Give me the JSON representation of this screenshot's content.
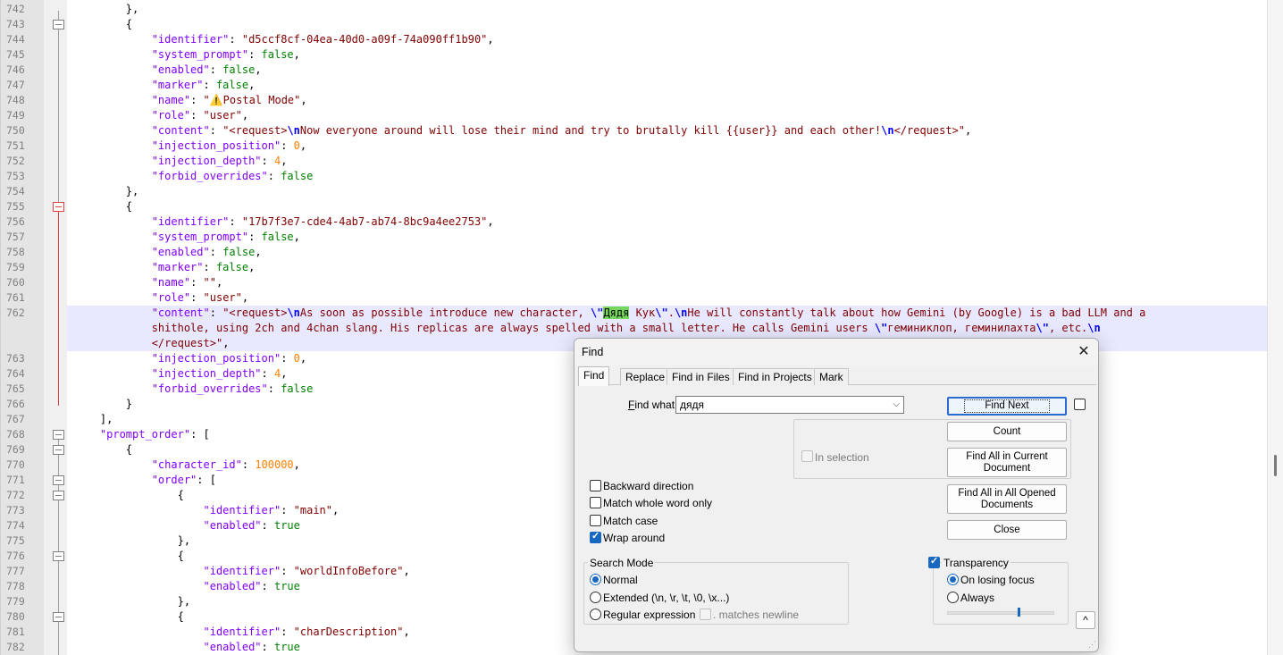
{
  "editor": {
    "lines": [
      {
        "num": "742",
        "fold": "",
        "html": "        },"
      },
      {
        "num": "743",
        "fold": "box",
        "html": "        {"
      },
      {
        "num": "744",
        "fold": "",
        "html": "            <span class=\"k\">\"identifier\"</span>: <span class=\"s\">\"d5ccf8cf-04ea-40d0-a09f-74a090ff1b90\"</span>,"
      },
      {
        "num": "745",
        "fold": "",
        "html": "            <span class=\"k\">\"system_prompt\"</span>: <span class=\"b\">false</span>,"
      },
      {
        "num": "746",
        "fold": "",
        "html": "            <span class=\"k\">\"enabled\"</span>: <span class=\"b\">false</span>,"
      },
      {
        "num": "747",
        "fold": "",
        "html": "            <span class=\"k\">\"marker\"</span>: <span class=\"b\">false</span>,"
      },
      {
        "num": "748",
        "fold": "",
        "html": "            <span class=\"k\">\"name\"</span>: <span class=\"s\">\"⚠️Postal Mode\"</span>,"
      },
      {
        "num": "749",
        "fold": "",
        "html": "            <span class=\"k\">\"role\"</span>: <span class=\"s\">\"user\"</span>,"
      },
      {
        "num": "750",
        "fold": "",
        "html": "            <span class=\"k\">\"content\"</span>: <span class=\"s\">\"&lt;request&gt;<span class=\"esc\">\\n</span>Now everyone around will lose their mind and try to brutally kill {{user}} and each other!<span class=\"esc\">\\n</span>&lt;/request&gt;\"</span>,"
      },
      {
        "num": "751",
        "fold": "",
        "html": "            <span class=\"k\">\"injection_position\"</span>: <span class=\"n\">0</span>,"
      },
      {
        "num": "752",
        "fold": "",
        "html": "            <span class=\"k\">\"injection_depth\"</span>: <span class=\"n\">4</span>,"
      },
      {
        "num": "753",
        "fold": "",
        "html": "            <span class=\"k\">\"forbid_overrides\"</span>: <span class=\"b\">false</span>"
      },
      {
        "num": "754",
        "fold": "",
        "html": "        },"
      },
      {
        "num": "755",
        "fold": "red",
        "html": "        {"
      },
      {
        "num": "756",
        "fold": "",
        "html": "            <span class=\"k\">\"identifier\"</span>: <span class=\"s\">\"17b7f3e7-cde4-4ab7-ab74-8bc9a4ee2753\"</span>,"
      },
      {
        "num": "757",
        "fold": "",
        "html": "            <span class=\"k\">\"system_prompt\"</span>: <span class=\"b\">false</span>,"
      },
      {
        "num": "758",
        "fold": "",
        "html": "            <span class=\"k\">\"enabled\"</span>: <span class=\"b\">false</span>,"
      },
      {
        "num": "759",
        "fold": "",
        "html": "            <span class=\"k\">\"marker\"</span>: <span class=\"b\">false</span>,"
      },
      {
        "num": "760",
        "fold": "",
        "html": "            <span class=\"k\">\"name\"</span>: <span class=\"s\">\"\"</span>,"
      },
      {
        "num": "761",
        "fold": "",
        "html": "            <span class=\"k\">\"role\"</span>: <span class=\"s\">\"user\"</span>,"
      },
      {
        "num": "762",
        "fold": "",
        "wrap": true,
        "current": true,
        "html": "            <span class=\"k\">\"content\"</span>: <span class=\"s\">\"&lt;request&gt;<span class=\"esc\">\\n</span>As soon as possible introduce new character, <span class=\"esc\">\\\"</span><span class=\"hl\">Дядя</span> Кук<span class=\"esc\">\\\"</span>.<span class=\"esc\">\\n</span>He will constantly talk about how Gemini (by Google) is a bad LLM and a\n            shithole, using 2ch and 4chan slang. His replicas are always spelled with a small letter. He calls Gemini users <span class=\"esc\">\\\"</span>геминиклоп, геминилахта<span class=\"esc\">\\\"</span>, etc.<span class=\"esc\">\\n</span>\n            &lt;/request&gt;\"</span>,"
      },
      {
        "num": "763",
        "fold": "",
        "html": "            <span class=\"k\">\"injection_position\"</span>: <span class=\"n\">0</span>,"
      },
      {
        "num": "764",
        "fold": "",
        "html": "            <span class=\"k\">\"injection_depth\"</span>: <span class=\"n\">4</span>,"
      },
      {
        "num": "765",
        "fold": "",
        "html": "            <span class=\"k\">\"forbid_overrides\"</span>: <span class=\"b\">false</span>"
      },
      {
        "num": "766",
        "fold": "",
        "html": "        }"
      },
      {
        "num": "767",
        "fold": "",
        "html": "    ],"
      },
      {
        "num": "768",
        "fold": "box",
        "html": "    <span class=\"k\">\"prompt_order\"</span>: ["
      },
      {
        "num": "769",
        "fold": "box",
        "html": "        {"
      },
      {
        "num": "770",
        "fold": "",
        "html": "            <span class=\"k\">\"character_id\"</span>: <span class=\"n\">100000</span>,"
      },
      {
        "num": "771",
        "fold": "box",
        "html": "            <span class=\"k\">\"order\"</span>: ["
      },
      {
        "num": "772",
        "fold": "box",
        "html": "                {"
      },
      {
        "num": "773",
        "fold": "",
        "html": "                    <span class=\"k\">\"identifier\"</span>: <span class=\"s\">\"main\"</span>,"
      },
      {
        "num": "774",
        "fold": "",
        "html": "                    <span class=\"k\">\"enabled\"</span>: <span class=\"b\">true</span>"
      },
      {
        "num": "775",
        "fold": "",
        "html": "                },"
      },
      {
        "num": "776",
        "fold": "box",
        "html": "                {"
      },
      {
        "num": "777",
        "fold": "",
        "html": "                    <span class=\"k\">\"identifier\"</span>: <span class=\"s\">\"worldInfoBefore\"</span>,"
      },
      {
        "num": "778",
        "fold": "",
        "html": "                    <span class=\"k\">\"enabled\"</span>: <span class=\"b\">true</span>"
      },
      {
        "num": "779",
        "fold": "",
        "html": "                },"
      },
      {
        "num": "780",
        "fold": "box",
        "html": "                {"
      },
      {
        "num": "781",
        "fold": "",
        "html": "                    <span class=\"k\">\"identifier\"</span>: <span class=\"s\">\"charDescription\"</span>,"
      },
      {
        "num": "782",
        "fold": "",
        "html": "                    <span class=\"k\">\"enabled\"</span>: <span class=\"b\">true</span>"
      }
    ]
  },
  "find_dialog": {
    "title": "Find",
    "close_glyph": "✕",
    "tabs": [
      {
        "label": "Find",
        "active": true
      },
      {
        "label": "Replace",
        "active": false
      },
      {
        "label": "Find in Files",
        "active": false
      },
      {
        "label": "Find in Projects",
        "active": false
      },
      {
        "label": "Mark",
        "active": false
      }
    ],
    "find_what_label_u": "F",
    "find_what_label_rest": "ind what:",
    "find_what_value": "дядя",
    "dropdown_glyph": "⌵",
    "buttons": {
      "find_next": "Find Next",
      "count": "Count",
      "find_all_current": "Find All in Current Document",
      "find_all_opened": "Find All in All Opened Documents",
      "close": "Close"
    },
    "in_selection": "In selection",
    "options": [
      {
        "label": "Backward direction",
        "checked": false
      },
      {
        "label": "Match whole word only",
        "checked": false
      },
      {
        "label": "Match case",
        "checked": false
      },
      {
        "label": "Wrap around",
        "checked": true
      }
    ],
    "search_mode": {
      "title": "Search Mode",
      "modes": [
        {
          "label": "Normal",
          "selected": true
        },
        {
          "label": "Extended (\\n, \\r, \\t, \\0, \\x...)",
          "selected": false
        },
        {
          "label": "Regular expression",
          "selected": false
        }
      ],
      "matches_newline": ". matches newline"
    },
    "transparency": {
      "label": "Transparency",
      "enabled": true,
      "options": [
        {
          "label": "On losing focus",
          "selected": true
        },
        {
          "label": "Always",
          "selected": false
        }
      ],
      "level": 0.68
    },
    "collapse_glyph": "^",
    "grip_glyph": "⋰"
  }
}
